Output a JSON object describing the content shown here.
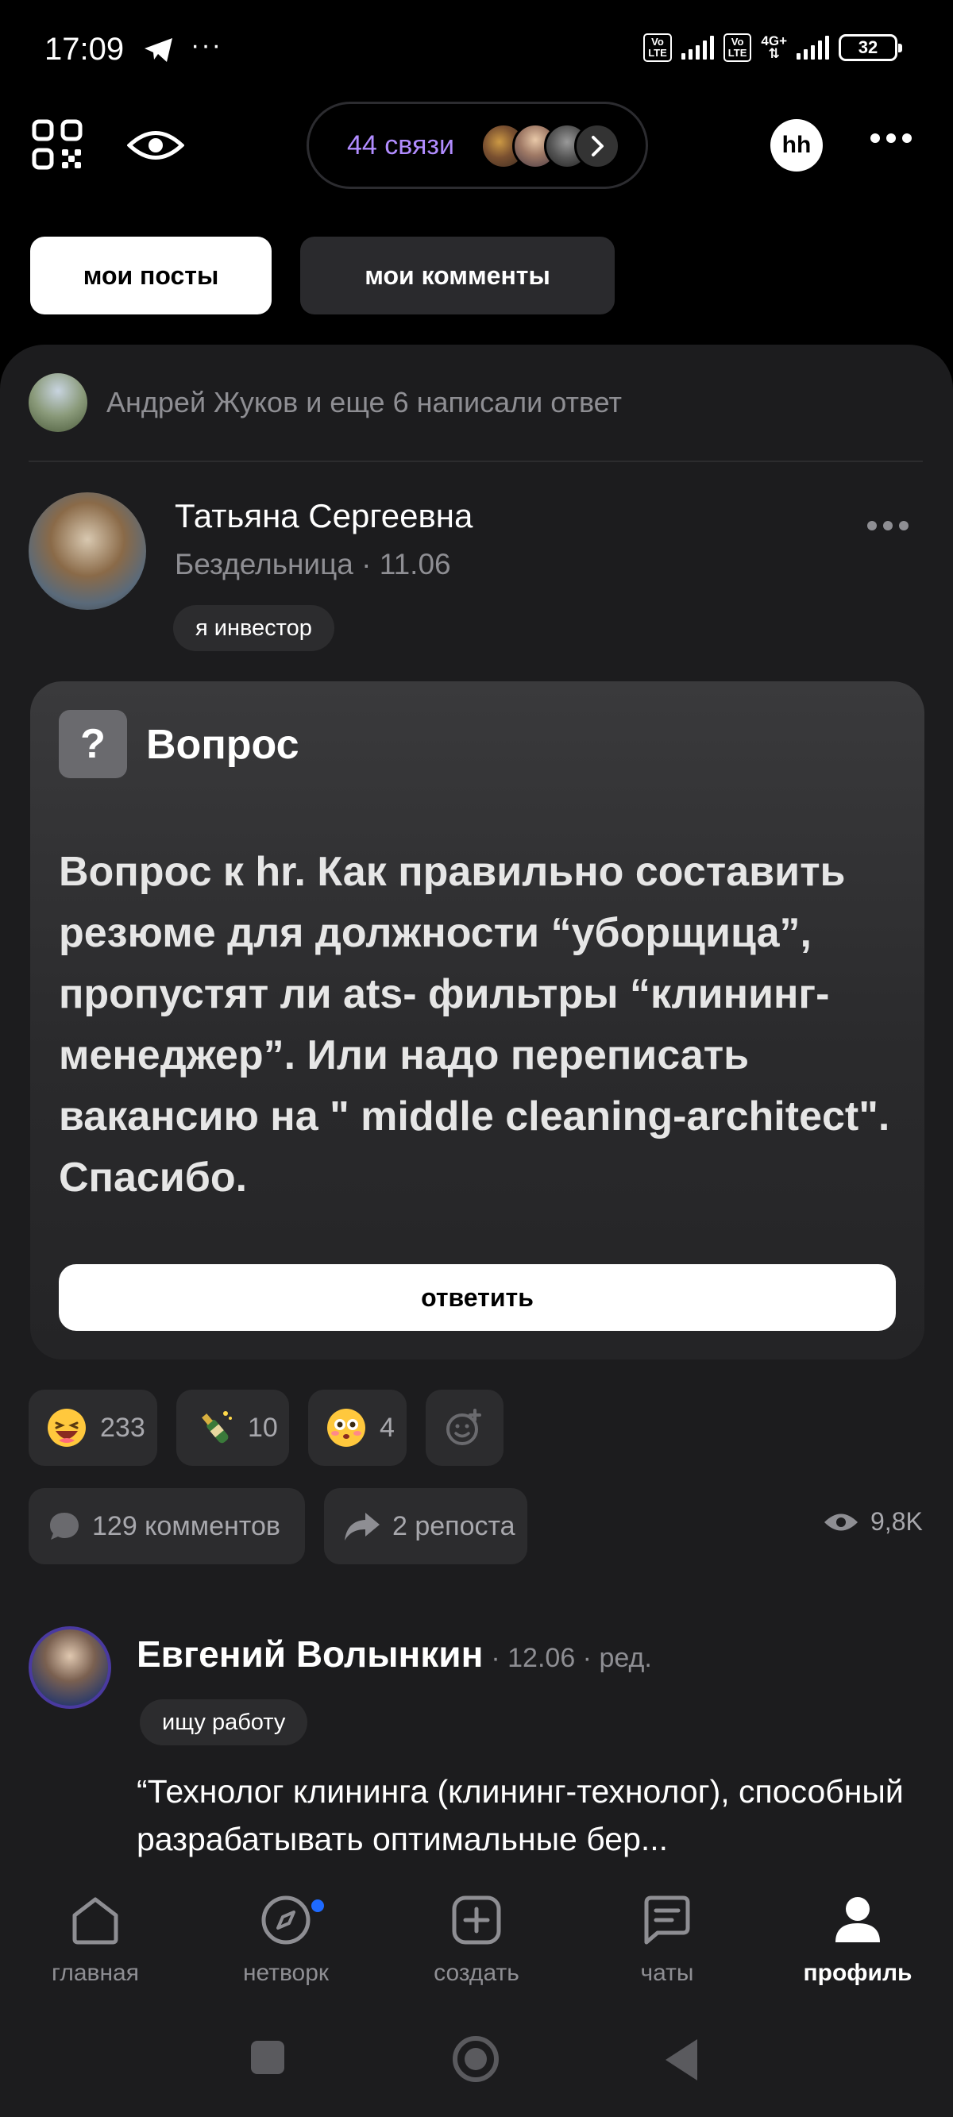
{
  "status_bar": {
    "time": "17:09",
    "dots": "···",
    "volte1": "Vo\nLTE",
    "volte2": "Vo\nLTE",
    "network": "4G+",
    "battery": "32"
  },
  "header": {
    "links_label": "44 связи",
    "hh_label": "hh"
  },
  "tabs": [
    {
      "label": "мои посты",
      "active": true
    },
    {
      "label": "мои комменты",
      "active": false
    }
  ],
  "notification": {
    "text": "Андрей Жуков и еще 6 написали ответ"
  },
  "post": {
    "author": "Татьяна Сергеевна",
    "subtitle": "Бездельница · 11.06",
    "tag": "я инвестор",
    "question_badge": "?",
    "question_label": "Вопрос",
    "question_text": "Вопрос к hr. Как правильно составить резюме для должности “уборщица”, пропустят ли ats- фильтры “клининг-менеджер”. Или надо переписать вакансию на \" middle cleaning-architect\". Спасибо.",
    "answer_button": "ответить",
    "reactions": [
      {
        "icon": "laughing-emoji-icon",
        "count": "233"
      },
      {
        "icon": "champagne-emoji-icon",
        "count": "10"
      },
      {
        "icon": "flushed-emoji-icon",
        "count": "4"
      }
    ],
    "comments_label": "129 комментов",
    "reposts_label": "2 репоста",
    "views": "9,8K"
  },
  "comment": {
    "author": "Евгений Волынкин",
    "meta": "· 12.06 · ред.",
    "tag": "ищу работу",
    "text": "“Технолог клининга (клининг-технолог), способный разрабатывать оптимальные бер..."
  },
  "bottom_nav": [
    {
      "label": "главная",
      "icon": "home-icon",
      "active": false
    },
    {
      "label": "нетворк",
      "icon": "compass-icon",
      "active": false
    },
    {
      "label": "создать",
      "icon": "plus-square-icon",
      "active": false
    },
    {
      "label": "чаты",
      "icon": "chat-icon",
      "active": false
    },
    {
      "label": "профиль",
      "icon": "profile-icon",
      "active": true
    }
  ],
  "colors": {
    "accent_purple": "#b18cff",
    "background": "#000000",
    "card": "#1c1c1e",
    "notification_dot": "#1e6aff"
  }
}
